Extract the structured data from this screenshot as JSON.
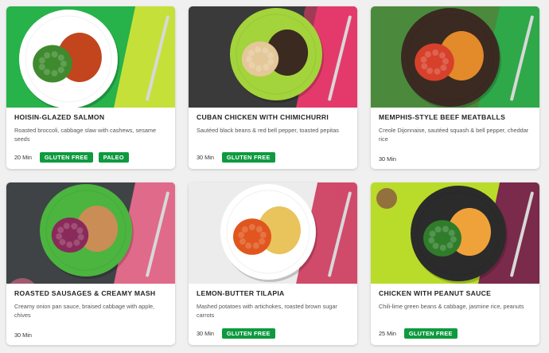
{
  "recipes": [
    {
      "title": "Hoisin-Glazed Salmon",
      "description": "Roasted broccoli, cabbage slaw with cashews, sesame seeds",
      "time": "20 Min",
      "tags": [
        "Gluten Free",
        "Paleo"
      ],
      "colors": {
        "background": "#27b24a",
        "accent": "#c6e03a",
        "plate": "#ffffff",
        "food": "#c2451e",
        "side": "#3f8a2e"
      }
    },
    {
      "title": "Cuban Chicken with Chimichurri",
      "description": "Sautéed black beans & red bell pepper, toasted pepitas",
      "time": "30 Min",
      "tags": [
        "Gluten Free"
      ],
      "colors": {
        "background": "#3a3a3a",
        "accent": "#e43a6b",
        "plate": "#a3d43b",
        "food": "#3b2a20",
        "side": "#e4c89a"
      }
    },
    {
      "title": "Memphis-Style Beef Meatballs",
      "description": "Creole Dijonnaise, sautéed squash & bell pepper, cheddar rice",
      "time": "30 Min",
      "tags": [],
      "colors": {
        "background": "#4b8a3c",
        "accent": "#2fa84a",
        "plate": "#3a2a22",
        "food": "#e38a2a",
        "side": "#d7402a"
      }
    },
    {
      "title": "Roasted Sausages & Creamy Mash",
      "description": "Creamy onion pan sauce, braised cabbage with apple, chives",
      "time": "30 Min",
      "tags": [],
      "colors": {
        "background": "#3f4346",
        "accent": "#e06a8a",
        "plate": "#4bb53f",
        "food": "#c98d55",
        "side": "#8a2a5a"
      }
    },
    {
      "title": "Lemon-Butter Tilapia",
      "description": "Mashed potatoes with artichokes, roasted brown sugar carrots",
      "time": "30 Min",
      "tags": [
        "Gluten Free"
      ],
      "colors": {
        "background": "#ececec",
        "accent": "#d04a6a",
        "plate": "#ffffff",
        "food": "#e9c35b",
        "side": "#e0561e"
      }
    },
    {
      "title": "Chicken with Peanut Sauce",
      "description": "Chili-lime green beans & cabbage, jasmine rice, peanuts",
      "time": "25 Min",
      "tags": [
        "Gluten Free"
      ],
      "colors": {
        "background": "#b9dc2a",
        "accent": "#7a2a4a",
        "plate": "#2b2b2b",
        "food": "#f0a23a",
        "side": "#2f7d2a"
      }
    }
  ]
}
